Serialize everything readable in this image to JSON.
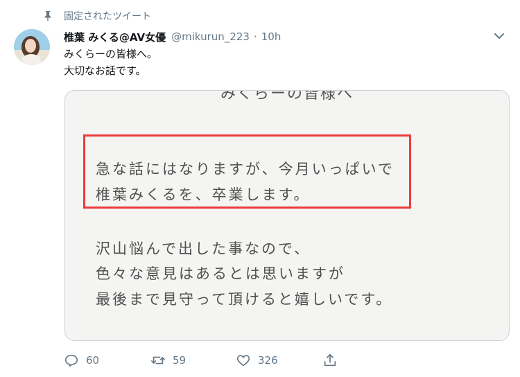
{
  "pinned": {
    "label": "固定されたツイート"
  },
  "tweet": {
    "display_name": "椎葉 みくる@AV女優",
    "handle": "@mikurun_223",
    "separator": "·",
    "time": "10h",
    "text_lines": [
      "みくらーの皆様へ。",
      "大切なお話です。"
    ]
  },
  "media": {
    "top_partial": "みくらーの皆様へ",
    "highlighted_lines": [
      "急な話にはなりますが、今月いっぱいで",
      "椎葉みくるを、卒業します。"
    ],
    "body_lines": [
      "沢山悩んで出した事なので、",
      "色々な意見はあるとは思いますが",
      "最後まで見守って頂けると嬉しいです。"
    ],
    "highlight_color": "#ec3b3b"
  },
  "actions": {
    "reply_count": "60",
    "retweet_count": "59",
    "like_count": "326"
  },
  "icons": [
    "pin-icon",
    "caret-down-icon",
    "reply-icon",
    "retweet-icon",
    "like-icon",
    "share-icon"
  ],
  "colors": {
    "text": "#14171a",
    "secondary": "#657786",
    "border": "#cbd3d9"
  }
}
